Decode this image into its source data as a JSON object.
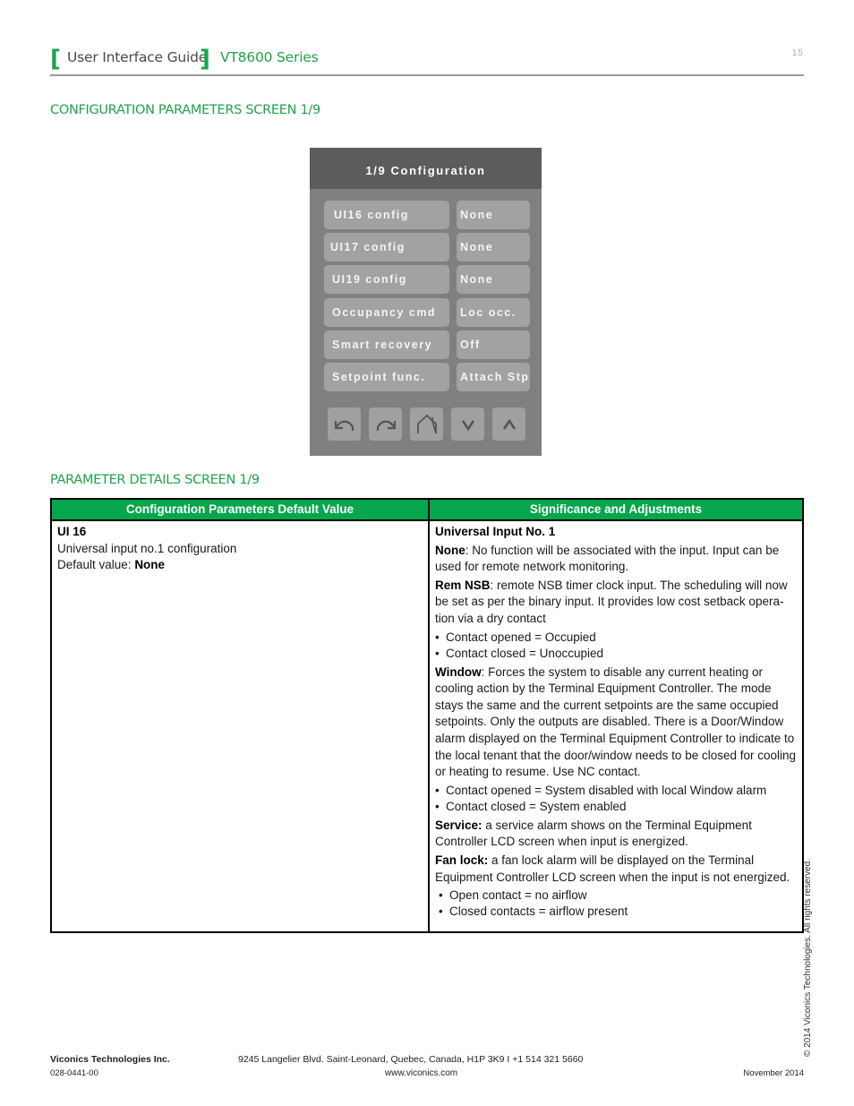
{
  "header": {
    "guide_title": "User Interface Guide",
    "series": "VT8600 Series",
    "page_number": "15",
    "accent_color": "#1fa34a"
  },
  "sections": {
    "config_screen_title": "CONFIGURATION PARAMETERS SCREEN 1/9",
    "details_title": "PARAMETER DETAILS SCREEN 1/9"
  },
  "device": {
    "title": "1/9 Configuration",
    "rows": [
      {
        "name": "UI16 config",
        "value": "None"
      },
      {
        "name": "UI17 config",
        "value": "None"
      },
      {
        "name": "UI19 config",
        "value": "None"
      },
      {
        "name": "Occupancy cmd",
        "value": "Loc occ."
      },
      {
        "name": "Smart recovery",
        "value": "Off"
      },
      {
        "name": "Setpoint func.",
        "value": "Attach Stp"
      }
    ],
    "nav_buttons": [
      "back-icon",
      "forward-icon",
      "home-icon",
      "chevron-down-icon",
      "chevron-up-icon"
    ]
  },
  "table": {
    "headers": [
      "Configuration Parameters Default Value",
      "Significance and Adjustments"
    ],
    "header_color": "#06a64c",
    "left": {
      "param": "UI 16",
      "description": "Universal input no.1 configuration",
      "default_label": "Default value: ",
      "default_value": "None"
    },
    "right": {
      "title": "Universal Input No. 1",
      "none_label": "None",
      "none_text": ": No function will be associated with the input. Input can be used for remote network monitoring.",
      "remnsb_label": "Rem NSB",
      "remnsb_text": ": remote NSB timer clock input. The scheduling will now be set as per the binary input. It provides low cost setback opera-tion via a dry contact",
      "remnsb_bullets": [
        "Contact opened = Occupied",
        "Contact closed = Unoccupied"
      ],
      "window_label": "Window",
      "window_text": ": Forces the system to disable any current heating or cooling action by the Terminal Equipment Controller. The mode stays the same and the current setpoints are the same occupied setpoints. Only the outputs are disabled. There is a Door/Window alarm displayed on the Terminal Equipment Controller to indicate to the local tenant that the door/window needs to be closed for cooling or heating to resume. Use NC contact.",
      "window_bullets": [
        "Contact opened = System disabled with local Window alarm",
        "Contact closed = System enabled"
      ],
      "service_label": "Service:",
      "service_text": " a service alarm shows on the Terminal Equipment Controller LCD screen when input is energized.",
      "fanlock_label": "Fan lock:",
      "fanlock_text": " a fan lock alarm will be displayed on the Terminal Equipment Controller LCD screen when the input is not energized.",
      "fanlock_bullets": [
        "Open contact = no airflow",
        "Closed contacts = airflow present"
      ]
    }
  },
  "copyright": "© 2014 Viconics Technologies. All rights reserved.",
  "footer": {
    "company": "Viconics Technologies Inc.",
    "address": "9245 Langelier Blvd. Saint-Leonard, Quebec, Canada, H1P 3K9   I  +1 514 321 5660",
    "doc_number": "028-0441-00",
    "website": "www.viconics.com",
    "date": "November 2014"
  }
}
